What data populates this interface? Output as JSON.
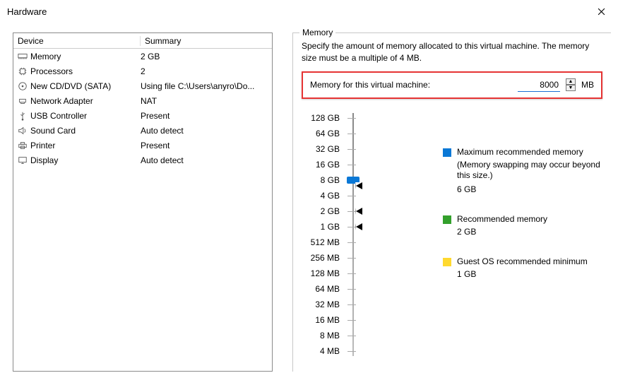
{
  "title": "Hardware",
  "left": {
    "headers": {
      "device": "Device",
      "summary": "Summary"
    },
    "rows": [
      {
        "name": "Memory",
        "summary": "2 GB"
      },
      {
        "name": "Processors",
        "summary": "2"
      },
      {
        "name": "New CD/DVD (SATA)",
        "summary": "Using file C:\\Users\\anyro\\Do..."
      },
      {
        "name": "Network Adapter",
        "summary": "NAT"
      },
      {
        "name": "USB Controller",
        "summary": "Present"
      },
      {
        "name": "Sound Card",
        "summary": "Auto detect"
      },
      {
        "name": "Printer",
        "summary": "Present"
      },
      {
        "name": "Display",
        "summary": "Auto detect"
      }
    ]
  },
  "memory": {
    "group": "Memory",
    "desc": "Specify the amount of memory allocated to this virtual machine. The memory size must be a multiple of 4 MB.",
    "label": "Memory for this virtual machine:",
    "value": "8000",
    "unit": "MB",
    "ticks": [
      "128 GB",
      "64 GB",
      "32 GB",
      "16 GB",
      "8 GB",
      "4 GB",
      "2 GB",
      "1 GB",
      "512 MB",
      "256 MB",
      "128 MB",
      "64 MB",
      "32 MB",
      "16 MB",
      "8 MB",
      "4 MB"
    ],
    "legend": {
      "max": {
        "label": "Maximum recommended memory",
        "sub": "(Memory swapping may occur beyond this size.)",
        "val": "6 GB"
      },
      "rec": {
        "label": "Recommended memory",
        "val": "2 GB"
      },
      "min": {
        "label": "Guest OS recommended minimum",
        "val": "1 GB"
      }
    }
  }
}
